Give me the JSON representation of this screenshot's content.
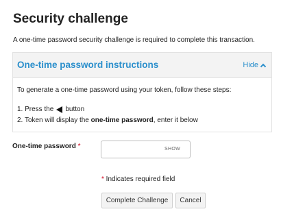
{
  "page": {
    "title": "Security challenge",
    "intro": "A one-time password security challenge is required to complete this transaction."
  },
  "panel": {
    "title": "One-time password instructions",
    "toggle_label": "Hide",
    "steps_intro": "To generate a one-time password using your token, follow these steps:",
    "step1_prefix": "1. Press the",
    "step1_suffix": "button",
    "step2_prefix": "2. Token will display the ",
    "step2_bold": "one-time password",
    "step2_suffix": ", enter it below"
  },
  "form": {
    "password_label": "One-time password",
    "required_marker": "*",
    "password_value": "",
    "show_label": "SHOW",
    "required_note_marker": "*",
    "required_note": " Indicates required field"
  },
  "actions": {
    "complete_label": "Complete Challenge",
    "cancel_label": "Cancel"
  },
  "colors": {
    "accent": "#2b8fcc",
    "required": "#d0021b"
  },
  "icons": {
    "toggle": "chevron-up-icon",
    "token_button": "left-triangle-icon"
  }
}
